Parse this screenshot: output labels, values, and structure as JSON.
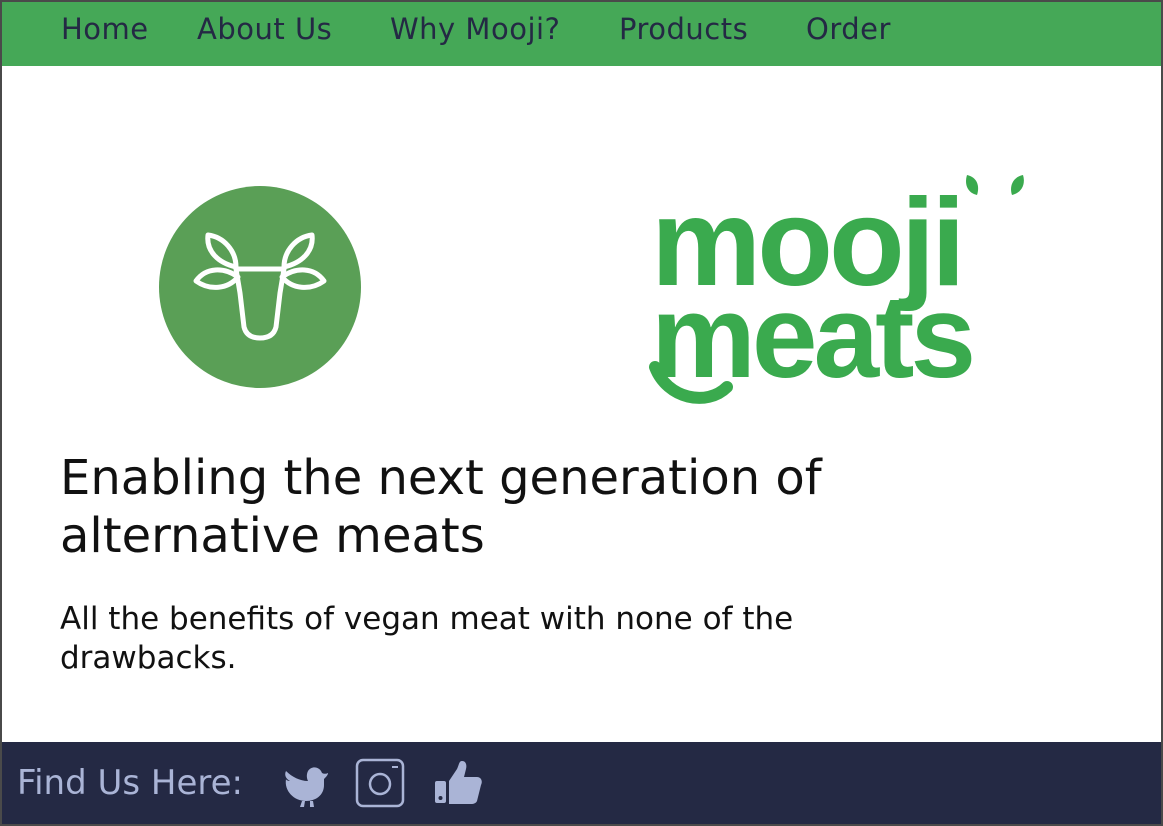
{
  "nav": {
    "items": [
      {
        "label": "Home"
      },
      {
        "label": "About Us"
      },
      {
        "label": "Why Mooji?"
      },
      {
        "label": "Products"
      },
      {
        "label": "Order"
      }
    ]
  },
  "hero": {
    "icon": "cow-head-icon",
    "wordmark_line1": "mooji",
    "wordmark_line2": "meats",
    "headline": "Enabling the next generation of alternative meats",
    "subline": "All the benefits of vegan meat with none of the drawbacks."
  },
  "footer": {
    "label": "Find Us Here:",
    "social": [
      {
        "icon": "twitter-bird-icon"
      },
      {
        "icon": "instagram-icon"
      },
      {
        "icon": "facebook-like-icon"
      }
    ]
  },
  "colors": {
    "nav_bg": "#45a857",
    "nav_text": "#242944",
    "brand_green": "#3aaa4e",
    "icon_circle": "#5a9f56",
    "footer_bg": "#242944",
    "footer_text": "#aab4d6",
    "body_text": "#111111"
  }
}
